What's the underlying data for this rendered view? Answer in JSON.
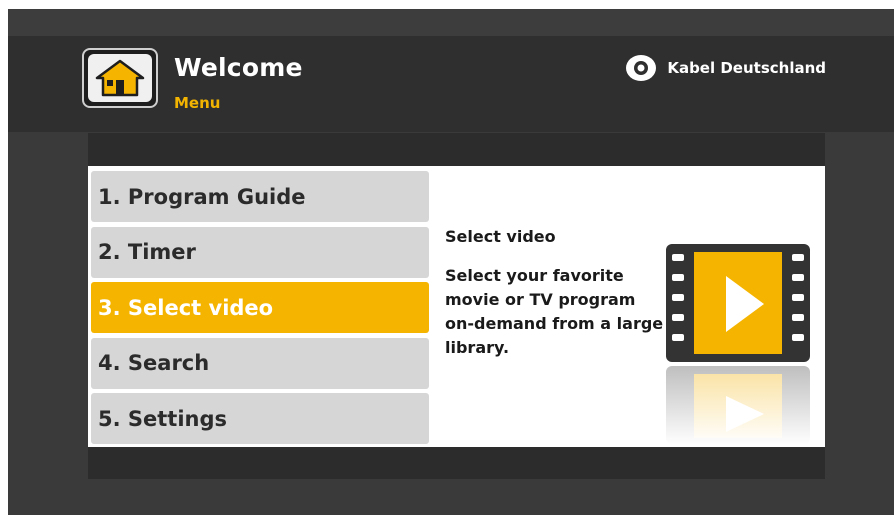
{
  "header": {
    "title": "Welcome",
    "subtitle": "Menu",
    "brand": "Kabel Deutschland"
  },
  "menu": {
    "items": [
      {
        "label": "1. Program Guide"
      },
      {
        "label": "2. Timer"
      },
      {
        "label": "3. Select video"
      },
      {
        "label": "4. Search"
      },
      {
        "label": "5. Settings"
      }
    ],
    "selected_index": 2
  },
  "detail": {
    "title": "Select video",
    "body": "Select your favorite movie or TV program on-demand from a large library.",
    "icon": "film-play-icon"
  },
  "icons": {
    "home": "home-icon",
    "brand_logo": "eye-logo-icon"
  },
  "colors": {
    "accent": "#f5b400",
    "background": "#3a3a3a",
    "menu_item": "#d6d6d6"
  }
}
